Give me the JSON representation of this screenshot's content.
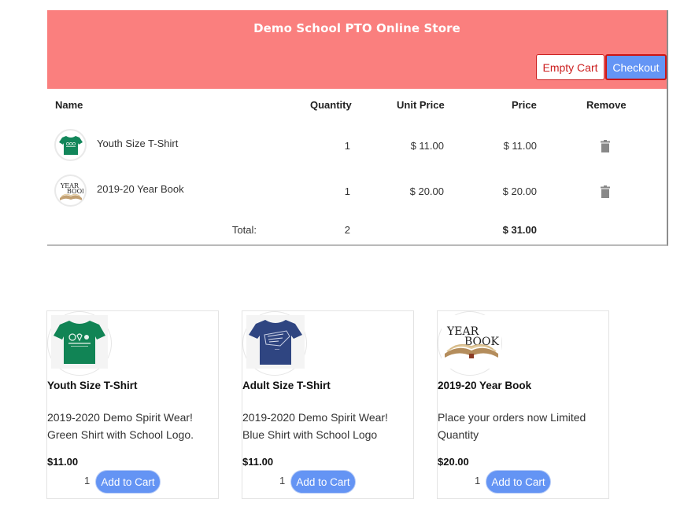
{
  "header": {
    "title": "Demo School PTO Online Store",
    "empty_cart_label": "Empty Cart",
    "checkout_label": "Checkout",
    "background_color": "#fa7f7e"
  },
  "cart": {
    "columns": {
      "name": "Name",
      "quantity": "Quantity",
      "unit_price": "Unit Price",
      "price": "Price",
      "remove": "Remove"
    },
    "items": [
      {
        "name": "Youth Size T-Shirt",
        "image": "green-tshirt-thumbnail",
        "quantity": "1",
        "unit_price": "$ 11.00",
        "price": "$ 11.00",
        "remove_icon": "trash-icon"
      },
      {
        "name": "2019-20 Year Book",
        "image": "yearbook-thumbnail",
        "quantity": "1",
        "unit_price": "$ 20.00",
        "price": "$ 20.00",
        "remove_icon": "trash-icon"
      }
    ],
    "total_label": "Total:",
    "total_quantity": "2",
    "total_price": "$ 31.00"
  },
  "products": [
    {
      "title": "Youth Size T-Shirt",
      "image": "green-tshirt-image",
      "description": "2019-2020 Demo Spirit Wear! Green Shirt with School Logo.",
      "price": "$11.00",
      "quantity": "1",
      "add_label": "Add to Cart"
    },
    {
      "title": "Adult Size T-Shirt",
      "image": "blue-tshirt-image",
      "description": "2019-2020 Demo Spirit Wear! Blue Shirt with School Logo",
      "price": "$11.00",
      "quantity": "1",
      "add_label": "Add to Cart"
    },
    {
      "title": "2019-20 Year Book",
      "image": "yearbook-image",
      "description": "Place your orders now Limited Quantity",
      "price": "$20.00",
      "quantity": "1",
      "add_label": "Add to Cart"
    }
  ],
  "colors": {
    "accent_blue": "#6494f4",
    "danger_red": "#cc1f1f"
  }
}
